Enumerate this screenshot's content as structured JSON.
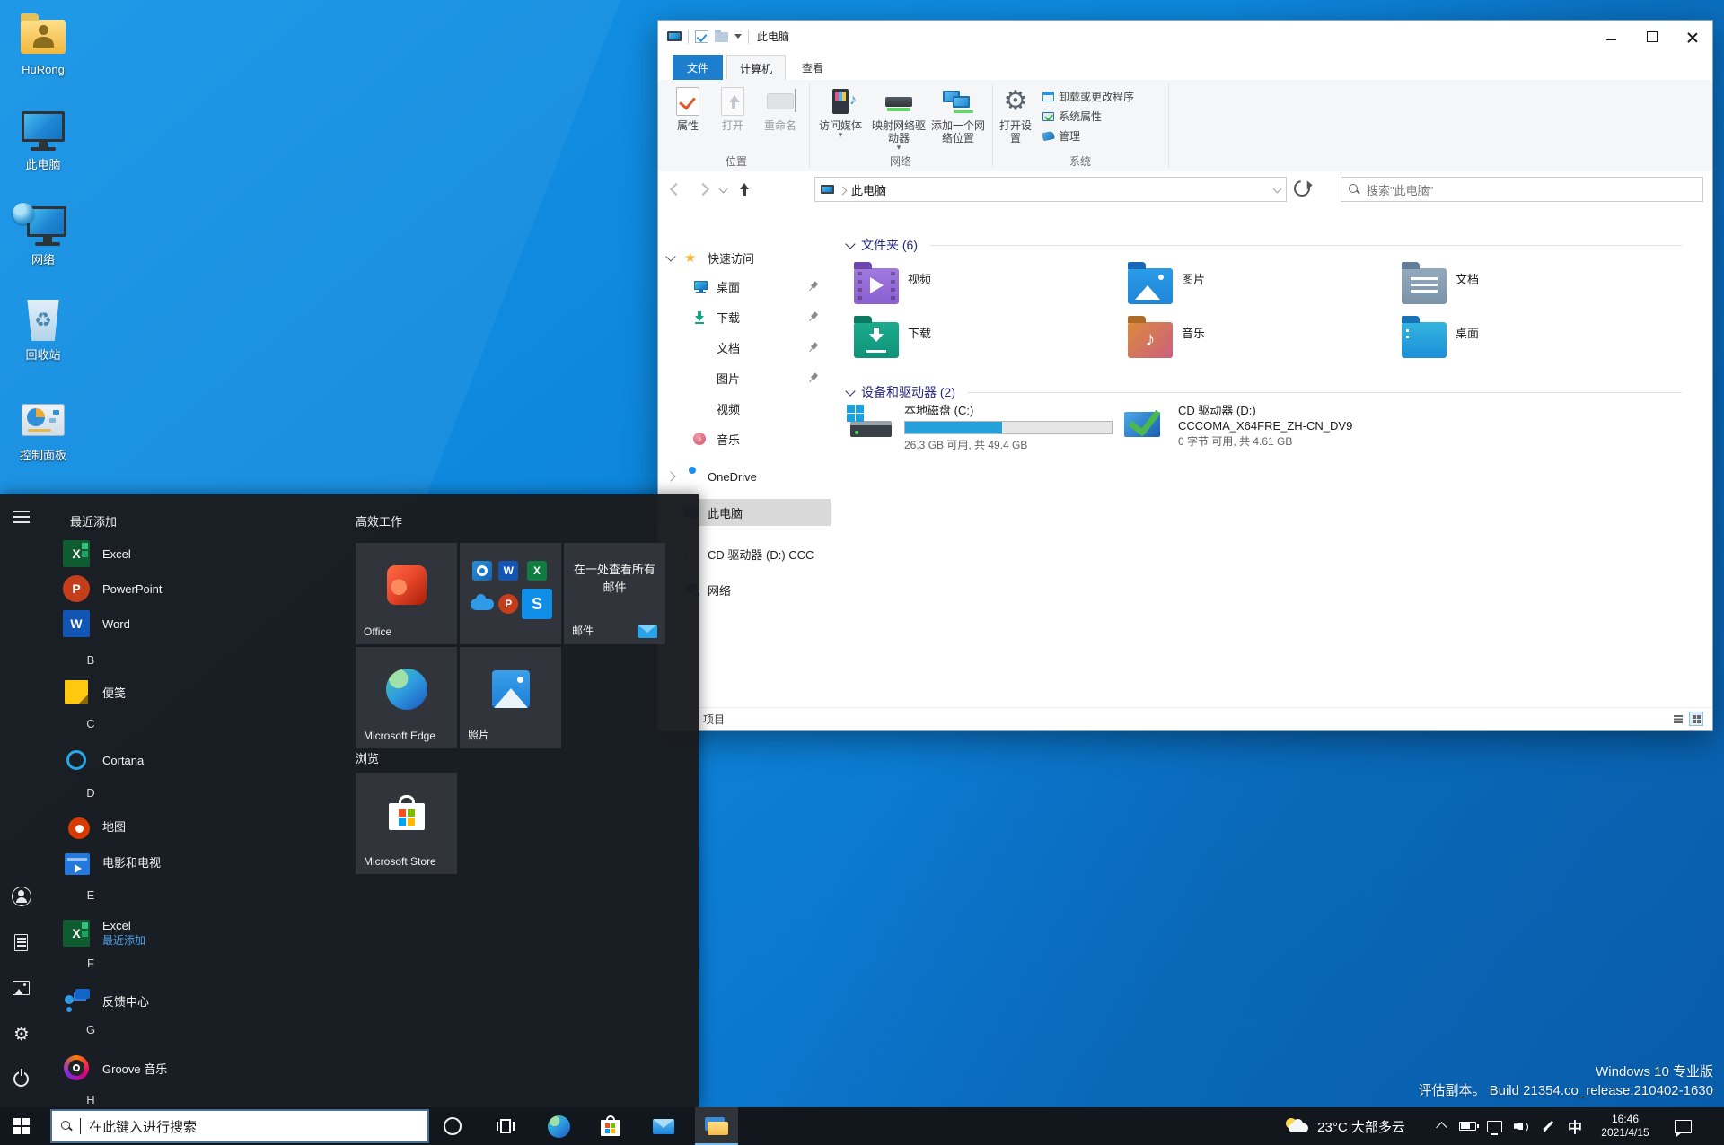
{
  "desktop": {
    "icons": [
      {
        "label": "HuRong"
      },
      {
        "label": "此电脑"
      },
      {
        "label": "网络"
      },
      {
        "label": "回收站"
      },
      {
        "label": "控制面板"
      }
    ],
    "watermark": {
      "line1": "Windows 10 专业版",
      "line2": "评估副本。  Build 21354.co_release.210402-1630"
    }
  },
  "explorer": {
    "title": "此电脑",
    "tabs": {
      "file": "文件",
      "computer": "计算机",
      "view": "查看"
    },
    "ribbon": {
      "properties": "属性",
      "open": "打开",
      "rename": "重命名",
      "access_media": "访问媒体",
      "map_drive": "映射网络驱动器",
      "add_network": "添加一个网络位置",
      "open_settings": "打开设置",
      "uninstall": "卸载或更改程序",
      "system_props": "系统属性",
      "manage": "管理",
      "group_location": "位置",
      "group_network": "网络",
      "group_system": "系统"
    },
    "address": {
      "breadcrumb": "此电脑",
      "search_placeholder": "搜索\"此电脑\""
    },
    "nav": [
      {
        "label": "快速访问"
      },
      {
        "label": "桌面"
      },
      {
        "label": "下载"
      },
      {
        "label": "文档"
      },
      {
        "label": "图片"
      },
      {
        "label": "视频"
      },
      {
        "label": "音乐"
      },
      {
        "label": "OneDrive"
      },
      {
        "label": "此电脑"
      },
      {
        "label": "CD 驱动器 (D:) CCC"
      },
      {
        "label": "网络"
      }
    ],
    "sections": {
      "folders_title": "文件夹 (6)",
      "folders": [
        {
          "name": "视频"
        },
        {
          "name": "图片"
        },
        {
          "name": "文档"
        },
        {
          "name": "下载"
        },
        {
          "name": "音乐"
        },
        {
          "name": "桌面"
        }
      ],
      "devices_title": "设备和驱动器 (2)",
      "drive_c": {
        "name": "本地磁盘 (C:)",
        "detail": "26.3 GB 可用, 共 49.4 GB",
        "percent_used": 47
      },
      "drive_d": {
        "name": "CD 驱动器 (D:)",
        "volume": "CCCOMA_X64FRE_ZH-CN_DV9",
        "detail": "0 字节 可用, 共 4.61 GB"
      }
    },
    "statusbar": {
      "items": "项目"
    }
  },
  "start_menu": {
    "recent_header": "最近添加",
    "apps": [
      {
        "label": "Excel"
      },
      {
        "label": "PowerPoint"
      },
      {
        "label": "Word"
      },
      {
        "letter": "B"
      },
      {
        "label": "便笺"
      },
      {
        "letter": "C"
      },
      {
        "label": "Cortana"
      },
      {
        "letter": "D"
      },
      {
        "label": "地图"
      },
      {
        "label": "电影和电视"
      },
      {
        "letter": "E"
      },
      {
        "label": "Excel",
        "sub": "最近添加"
      },
      {
        "letter": "F"
      },
      {
        "label": "反馈中心"
      },
      {
        "letter": "G"
      },
      {
        "label": "Groove 音乐"
      },
      {
        "letter": "H"
      }
    ],
    "groups": {
      "work": "高效工作",
      "browse": "浏览"
    },
    "tiles": {
      "office": "Office",
      "mail_text": "在一处查看所有邮件",
      "mail_label": "邮件",
      "edge": "Microsoft Edge",
      "photos": "照片",
      "store": "Microsoft Store"
    }
  },
  "taskbar": {
    "search_placeholder": "在此键入进行搜索",
    "tray": {
      "weather": "23°C 大部多云",
      "ime": "中",
      "time": "16:46",
      "date": "2021/4/15"
    }
  }
}
